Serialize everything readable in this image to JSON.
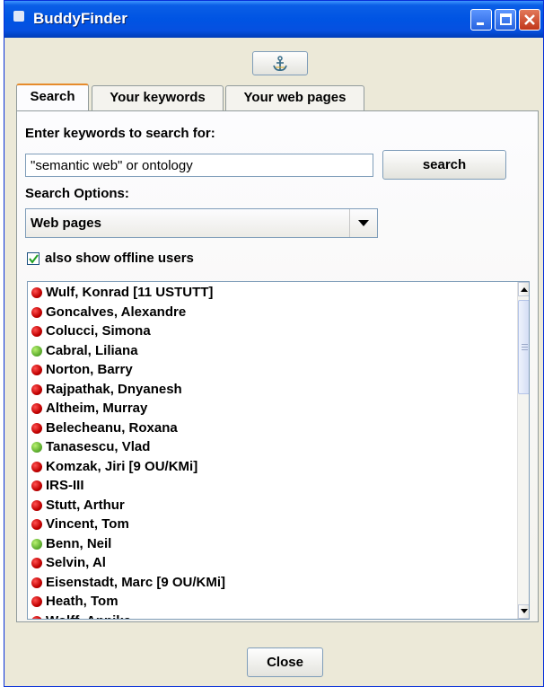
{
  "window": {
    "title": "BuddyFinder"
  },
  "toolbar": {
    "icon": "anchor-icon"
  },
  "tabs": [
    {
      "label": "Search",
      "active": true
    },
    {
      "label": "Your keywords",
      "active": false
    },
    {
      "label": "Your web pages",
      "active": false
    }
  ],
  "search": {
    "keywords_label": "Enter keywords to search for:",
    "query_value": "\"semantic web\" or ontology",
    "button_label": "search",
    "options_label": "Search Options:",
    "option_selected": "Web pages",
    "offline_checkbox": {
      "label": "also show offline users",
      "checked": true
    }
  },
  "results": [
    {
      "name": "Wulf, Konrad [11 USTUTT]",
      "status": "offline"
    },
    {
      "name": "Goncalves, Alexandre",
      "status": "offline"
    },
    {
      "name": "Colucci, Simona",
      "status": "offline"
    },
    {
      "name": "Cabral, Liliana",
      "status": "online"
    },
    {
      "name": "Norton, Barry",
      "status": "offline"
    },
    {
      "name": "Rajpathak, Dnyanesh",
      "status": "offline"
    },
    {
      "name": "Altheim, Murray",
      "status": "offline"
    },
    {
      "name": "Belecheanu, Roxana",
      "status": "offline"
    },
    {
      "name": "Tanasescu, Vlad",
      "status": "online"
    },
    {
      "name": "Komzak, Jiri [9 OU/KMi]",
      "status": "offline"
    },
    {
      "name": "IRS-III",
      "status": "offline"
    },
    {
      "name": "Stutt, Arthur",
      "status": "offline"
    },
    {
      "name": "Vincent, Tom",
      "status": "offline"
    },
    {
      "name": "Benn, Neil",
      "status": "online"
    },
    {
      "name": "Selvin, Al",
      "status": "offline"
    },
    {
      "name": "Eisenstadt, Marc [9 OU/KMi]",
      "status": "offline"
    },
    {
      "name": "Heath, Tom",
      "status": "offline"
    },
    {
      "name": "Wolff, Annika",
      "status": "offline"
    }
  ],
  "footer": {
    "close_label": "Close"
  },
  "colors": {
    "online": "#60b030",
    "offline": "#c00000",
    "titlebar": "#0054e3",
    "tab_accent": "#e68b2c"
  }
}
